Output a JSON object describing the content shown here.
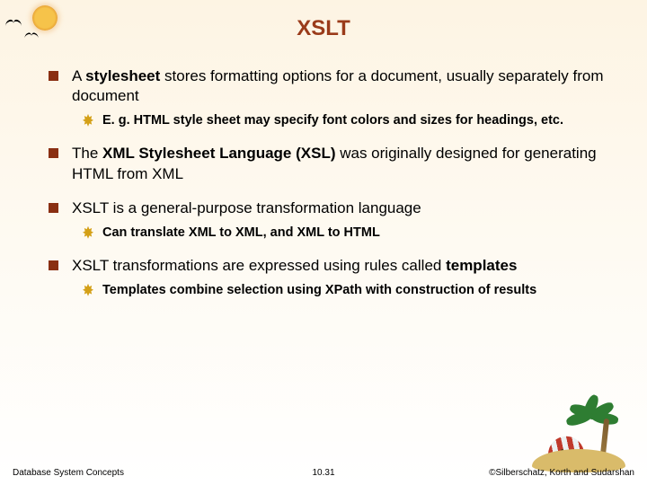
{
  "title": "XSLT",
  "bullets": {
    "b1_pre": "A ",
    "b1_term": "stylesheet",
    "b1_post": " stores formatting options for a document, usually separately from document",
    "b1_sub1": "E. g. HTML style sheet may specify font colors and sizes for headings, etc.",
    "b2_pre": "The ",
    "b2_term": "XML Stylesheet Language (XSL)",
    "b2_post": " was originally designed for generating HTML from XML",
    "b3": "XSLT is a general-purpose transformation language",
    "b3_sub1": "Can translate XML to XML, and XML to HTML",
    "b4_pre": "XSLT transformations are expressed using rules called ",
    "b4_term": "templates",
    "b4_sub1": "Templates combine selection using XPath with construction of results"
  },
  "footer": {
    "left": "Database System Concepts",
    "center": "10.31",
    "right": "©Silberschatz, Korth and Sudarshan"
  }
}
